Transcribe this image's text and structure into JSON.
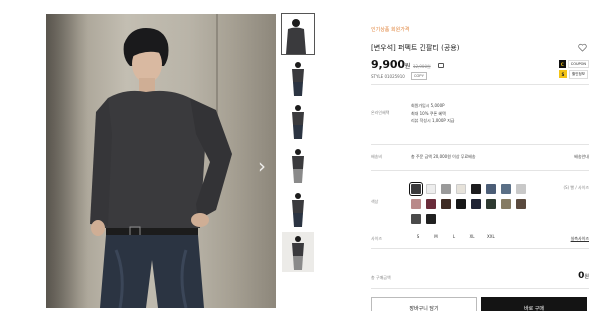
{
  "product": {
    "brand": "인기상품 회원가격",
    "title": "[변우석] 퍼펙트 긴팔티 (공용)",
    "price": "9,900",
    "price_unit": "원",
    "old_price": "12,900원",
    "style_code": "STYLE 01025910",
    "copy_label": "COPY"
  },
  "coupons": [
    {
      "mark": "C",
      "label": "COUPON"
    },
    {
      "mark": "S",
      "label": "할인정보"
    }
  ],
  "benefits": {
    "label": "온라인혜택",
    "lines": [
      "회원가입시 5,000P",
      "최대 10% 쿠폰 혜택",
      "리뷰 작성시 1,000P 지급"
    ]
  },
  "shipping": {
    "label": "배송비",
    "text": "총 주문 금액 20,000원 이상 무료배송",
    "link": "배송안내"
  },
  "colors": {
    "label": "색상",
    "guide": "(S) 빨 / 사이즈",
    "swatches": [
      {
        "name": "charcoal",
        "color": "#3b3b3d",
        "selected": true
      },
      {
        "name": "white",
        "color": "#ededed"
      },
      {
        "name": "grey",
        "color": "#9a9a9a"
      },
      {
        "name": "ivory",
        "color": "#e6e2da"
      },
      {
        "name": "black",
        "color": "#1c1c1e"
      },
      {
        "name": "navy-blue",
        "color": "#4b5d76"
      },
      {
        "name": "steel-blue",
        "color": "#5a6f86"
      },
      {
        "name": "light-grey",
        "color": "#c8c8c8"
      },
      {
        "name": "dusty-pink",
        "color": "#b98a8a"
      },
      {
        "name": "wine",
        "color": "#6a2c3a"
      },
      {
        "name": "brown",
        "color": "#3d2a22"
      },
      {
        "name": "deep-black",
        "color": "#171717"
      },
      {
        "name": "navy",
        "color": "#1e2233"
      },
      {
        "name": "forest",
        "color": "#2e3a31"
      },
      {
        "name": "khaki",
        "color": "#857b63"
      },
      {
        "name": "mocha",
        "color": "#5a4a3e"
      },
      {
        "name": "dark-grey",
        "color": "#4a4a4a"
      },
      {
        "name": "black-2",
        "color": "#202020"
      }
    ]
  },
  "sizes": {
    "label": "사이즈",
    "options": [
      "S",
      "M",
      "L",
      "XL",
      "XXL"
    ],
    "guide": "실측사이즈"
  },
  "total": {
    "label": "총 구매금액",
    "value": "0",
    "unit": "원"
  },
  "actions": {
    "cart": "장바구니 담기",
    "buy": "바로 구매"
  },
  "gallery": {
    "next_arrow": "›",
    "thumbnail_count": 6
  }
}
